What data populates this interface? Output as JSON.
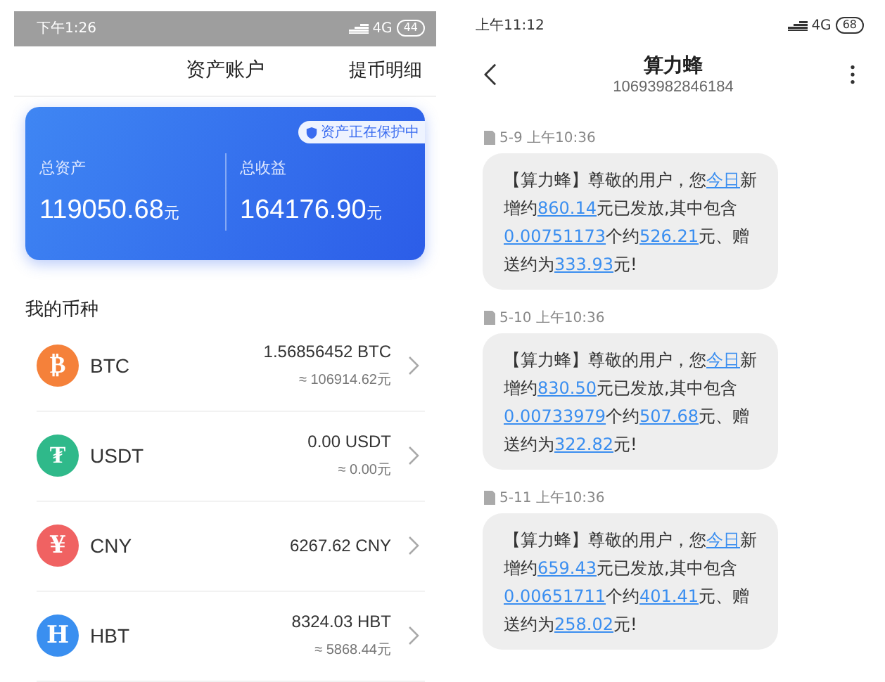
{
  "left_phone": {
    "status_bar": {
      "time": "下午1:26",
      "network": "4G",
      "battery": "44"
    },
    "header": {
      "title": "资产账户",
      "action": "提币明细"
    },
    "summary_card": {
      "badge": "资产正在保护中",
      "stats": [
        {
          "label": "总资产",
          "value": "119050.68",
          "unit": "元"
        },
        {
          "label": "总收益",
          "value": "164176.90",
          "unit": "元"
        }
      ]
    },
    "section_title": "我的币种",
    "coins": [
      {
        "glyph": "₿",
        "color": "#f5813a",
        "name": "BTC",
        "amount": "1.56856452 BTC",
        "fiat": "≈ 106914.62元"
      },
      {
        "glyph": "₮",
        "color": "#2fb98a",
        "name": "USDT",
        "amount": "0.00 USDT",
        "fiat": "≈ 0.00元"
      },
      {
        "glyph": "¥",
        "color": "#f06262",
        "name": "CNY",
        "amount": "6267.62 CNY"
      },
      {
        "glyph": "H",
        "color": "#3a8ff0",
        "name": "HBT",
        "amount": "8324.03 HBT",
        "fiat": "≈ 5868.44元"
      }
    ]
  },
  "right_phone": {
    "status_bar": {
      "time": "上午11:12",
      "network": "4G",
      "battery": "68"
    },
    "header": {
      "title": "算力蜂",
      "number": "10693982846184"
    },
    "messages": [
      {
        "time": "5-9 上午10:36",
        "segments": [
          {
            "text": "【算力蜂】尊敬的用户，您",
            "link": false
          },
          {
            "text": "今日",
            "link": true
          },
          {
            "text": "新增约",
            "link": false
          },
          {
            "text": "860.14",
            "link": true
          },
          {
            "text": "元已发放,其中包含",
            "link": false
          },
          {
            "text": "0.00751173",
            "link": true
          },
          {
            "text": "个约",
            "link": false
          },
          {
            "text": "526.21",
            "link": true
          },
          {
            "text": "元、赠送约为",
            "link": false
          },
          {
            "text": "333.93",
            "link": true
          },
          {
            "text": "元!",
            "link": false
          }
        ]
      },
      {
        "time": "5-10 上午10:36",
        "segments": [
          {
            "text": "【算力蜂】尊敬的用户，您",
            "link": false
          },
          {
            "text": "今日",
            "link": true
          },
          {
            "text": "新增约",
            "link": false
          },
          {
            "text": "830.50",
            "link": true
          },
          {
            "text": "元已发放,其中包含",
            "link": false
          },
          {
            "text": "0.00733979",
            "link": true
          },
          {
            "text": "个约",
            "link": false
          },
          {
            "text": "507.68",
            "link": true
          },
          {
            "text": "元、赠送约为",
            "link": false
          },
          {
            "text": "322.82",
            "link": true
          },
          {
            "text": "元!",
            "link": false
          }
        ]
      },
      {
        "time": "5-11 上午10:36",
        "segments": [
          {
            "text": "【算力蜂】尊敬的用户，您",
            "link": false
          },
          {
            "text": "今日",
            "link": true
          },
          {
            "text": "新增约",
            "link": false
          },
          {
            "text": "659.43",
            "link": true
          },
          {
            "text": "元已发放,其中包含",
            "link": false
          },
          {
            "text": "0.00651711",
            "link": true
          },
          {
            "text": "个约",
            "link": false
          },
          {
            "text": "401.41",
            "link": true
          },
          {
            "text": "元、赠送约为",
            "link": false
          },
          {
            "text": "258.02",
            "link": true
          },
          {
            "text": "元!",
            "link": false
          }
        ]
      }
    ]
  }
}
